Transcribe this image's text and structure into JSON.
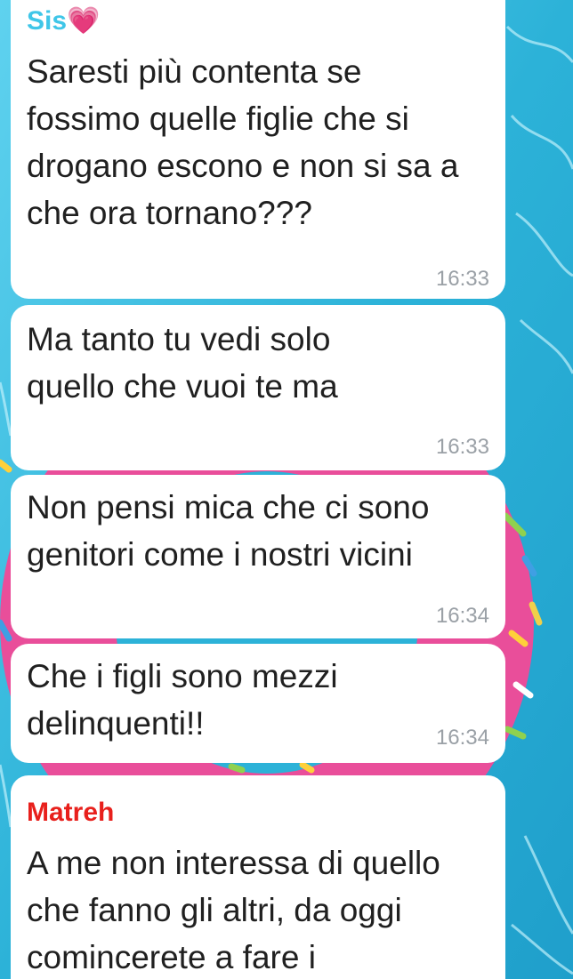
{
  "wallpaper": {
    "description_icon": "pool-water-donut-wallpaper",
    "water_color": "#2fb6d8",
    "donut_color": "#e94e9a"
  },
  "messages": [
    {
      "sender": "Sis💗",
      "sender_color": "#3fc6e8",
      "text": "Saresti più contenta se fossimo quelle figlie che si drogano escono e non si sa a che ora tornano???",
      "time": "16:33"
    },
    {
      "text": "Ma tanto tu vedi solo quello che vuoi te ma",
      "time": "16:33"
    },
    {
      "text": "Non pensi mica che ci sono genitori come i nostri vicini",
      "time": "16:34"
    },
    {
      "text": "Che i figli sono mezzi delinquenti!!",
      "time": "16:34"
    },
    {
      "sender": "Matreh",
      "sender_color": "#e8201c",
      "text": "A me non interessa di quello che fanno gli altri, da oggi comincerete a fare i"
    }
  ]
}
